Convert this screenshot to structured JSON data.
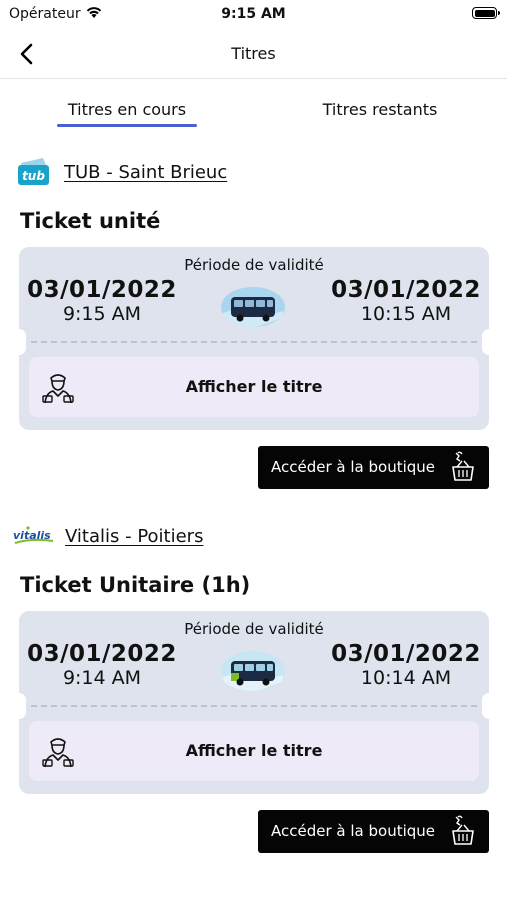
{
  "status_bar": {
    "carrier": "Opérateur",
    "time": "9:15 AM"
  },
  "navbar": {
    "title": "Titres"
  },
  "tabs": [
    {
      "label": "Titres en cours",
      "active": true
    },
    {
      "label": "Titres restants",
      "active": false
    }
  ],
  "colors": {
    "accent": "#4a5fd1",
    "card_bg": "#dfe3ee",
    "show_btn_bg": "#efeaf8",
    "shop_btn_bg": "#050505"
  },
  "tickets": [
    {
      "operator": "TUB - Saint Brieuc",
      "logo_text": "tub",
      "ticket_name": "Ticket unité",
      "period_label": "Période de validité",
      "start_date": "03/01/2022",
      "start_time": "9:15 AM",
      "end_date": "03/01/2022",
      "end_time": "10:15 AM",
      "show_label": "Afficher le titre",
      "shop_label": "Accéder à la boutique"
    },
    {
      "operator": "Vitalis - Poitiers",
      "logo_text": "vitalis",
      "ticket_name": "Ticket Unitaire (1h)",
      "period_label": "Période de validité",
      "start_date": "03/01/2022",
      "start_time": "9:14 AM",
      "end_date": "03/01/2022",
      "end_time": "10:14 AM",
      "show_label": "Afficher le titre",
      "shop_label": "Accéder à la boutique"
    }
  ]
}
